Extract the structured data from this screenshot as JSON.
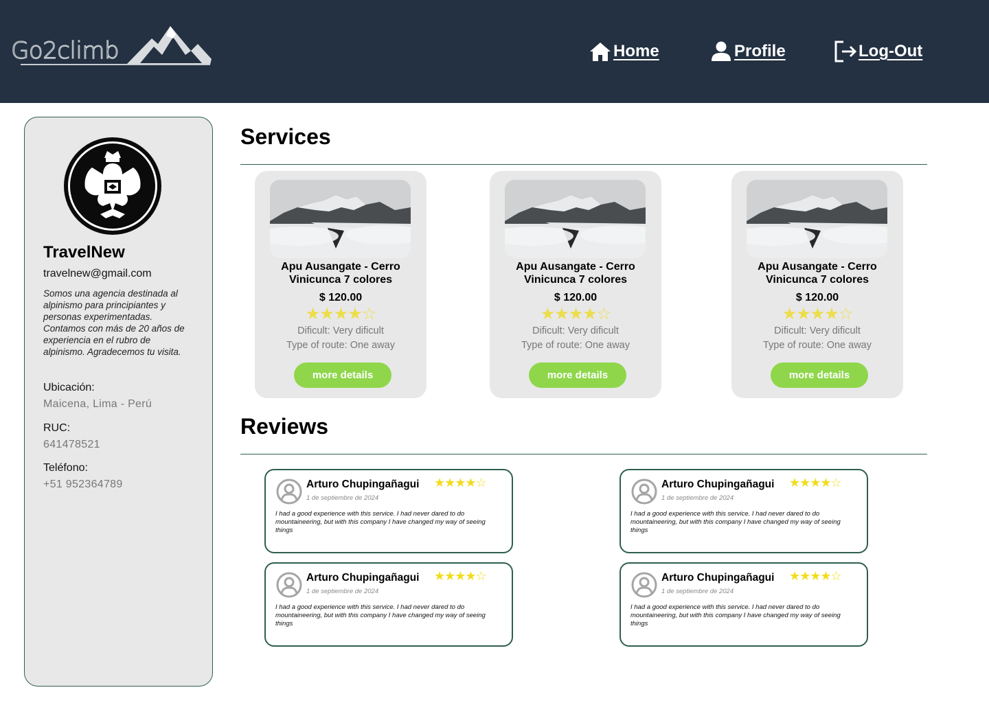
{
  "header": {
    "logo_text": "Go2climb",
    "nav": {
      "home": "Home",
      "profile": "Profile",
      "logout": "Log-Out"
    }
  },
  "agency": {
    "name": "TravelNew",
    "email": "travelnew@gmail.com",
    "description": "Somos una agencia destinada al alpinismo para principiantes y personas experimentadas. Contamos con más de 20 años de experiencia en el rubro de alpinismo. Agradecemos tu visita.",
    "location_label": "Ubicación:",
    "location": "Maicena, Lima - Perú",
    "ruc_label": "RUC:",
    "ruc": "641478521",
    "phone_label": "Teléfono:",
    "phone": "+51 952364789"
  },
  "services": {
    "title": "Services",
    "items": [
      {
        "title": "Apu Ausangate - Cerro Vinicunca 7 colores",
        "price": "$ 120.00",
        "rating": 4,
        "rating_max": 5,
        "difficulty": "Dificult: Very dificult",
        "route": "Type of route: One away",
        "button": "more details"
      },
      {
        "title": "Apu Ausangate - Cerro Vinicunca 7 colores",
        "price": "$ 120.00",
        "rating": 4,
        "rating_max": 5,
        "difficulty": "Dificult: Very dificult",
        "route": "Type of route: One away",
        "button": "more details"
      },
      {
        "title": "Apu Ausangate - Cerro Vinicunca 7 colores",
        "price": "$ 120.00",
        "rating": 4,
        "rating_max": 5,
        "difficulty": "Dificult: Very dificult",
        "route": "Type of route: One away",
        "button": "more details"
      }
    ]
  },
  "reviews": {
    "title": "Reviews",
    "items": [
      {
        "name": "Arturo Chupingañagui",
        "date": "1 de septiembre de 2024",
        "rating": 4,
        "rating_max": 5,
        "text": "I had a good experience with this service. I had never dared to do mountaineering, but with this company I have changed my way of seeing things"
      },
      {
        "name": "Arturo Chupingañagui",
        "date": "1 de septiembre de 2024",
        "rating": 4,
        "rating_max": 5,
        "text": "I had a good experience with this service. I had never dared to do mountaineering, but with this company I have changed my way of seeing things"
      },
      {
        "name": "Arturo Chupingañagui",
        "date": "1 de septiembre de 2024",
        "rating": 4,
        "rating_max": 5,
        "text": "I had a good experience with this service. I had never dared to do mountaineering, but with this company I have changed my way of seeing things"
      },
      {
        "name": "Arturo Chupingañagui",
        "date": "1 de septiembre de 2024",
        "rating": 4,
        "rating_max": 5,
        "text": "I had a good experience with this service. I had never dared to do mountaineering, but with this company I have changed my way of seeing things"
      }
    ]
  },
  "colors": {
    "header_bg": "#233142",
    "panel_bg": "#e8e8e8",
    "border_green": "#2e5e4e",
    "button_green": "#8fd64b",
    "star_yellow": "#ecdd4a"
  },
  "icons": {
    "home": "home-icon",
    "profile": "user-icon",
    "logout": "logout-icon",
    "logo": "mountain-icon",
    "agency_avatar": "eagle-crest-icon",
    "review_avatar": "user-circle-icon"
  }
}
